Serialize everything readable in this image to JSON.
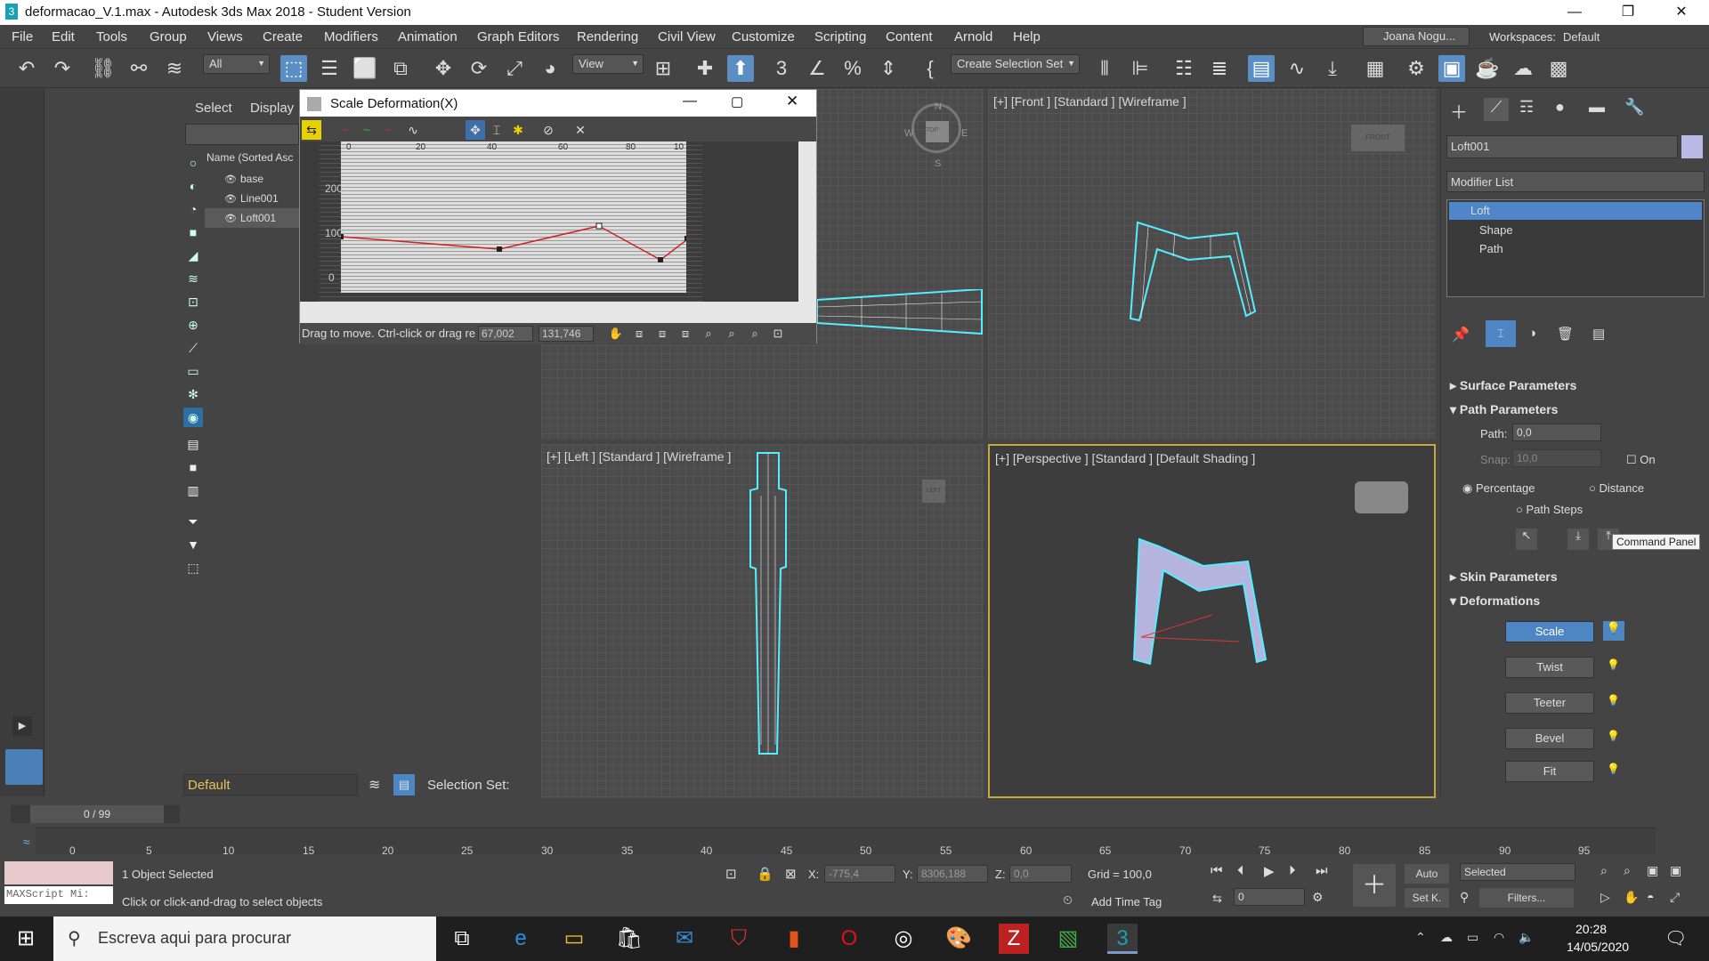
{
  "window": {
    "title": "deformacao_V.1.max - Autodesk 3ds Max 2018 - Student Version",
    "logo": "3"
  },
  "menu": [
    "File",
    "Edit",
    "Tools",
    "Group",
    "Views",
    "Create",
    "Modifiers",
    "Animation",
    "Graph Editors",
    "Rendering",
    "Civil View",
    "Customize",
    "Scripting",
    "Content",
    "Arnold",
    "Help"
  ],
  "user": {
    "name": "Joana Nogu...",
    "workspaces_label": "Workspaces:",
    "workspace": "Default"
  },
  "toolbar": {
    "filter": "All",
    "view": "View",
    "selection_set": "Create Selection Set"
  },
  "scene": {
    "tab_select": "Select",
    "tab_display": "Display",
    "column_header": "Name (Sorted Asc",
    "items": [
      "base",
      "Line001",
      "Loft001"
    ]
  },
  "dialog": {
    "title": "Scale Deformation(X)",
    "ruler": [
      "0",
      "20",
      "40",
      "60",
      "80",
      "10"
    ],
    "yticks": [
      "200",
      "100",
      "0"
    ],
    "status": "Drag to move. Ctrl-click or drag re",
    "x_value": "67,002",
    "y_value": "131,746"
  },
  "viewports": {
    "top": "",
    "front": "[+] [Front ] [Standard ] [Wireframe ]",
    "left": "[+] [Left ] [Standard ] [Wireframe ]",
    "perspective": "[+] [Perspective ] [Standard ] [Default Shading ]",
    "cube_front": "FRONT",
    "cube_left": "LEFT",
    "cube_top": "TOP",
    "compass": {
      "n": "N",
      "s": "S",
      "e": "E",
      "w": "W"
    }
  },
  "panel": {
    "object_name": "Loft001",
    "modifier_list": "Modifier List",
    "stack": [
      "Loft",
      "Shape",
      "Path"
    ],
    "surface_params": "Surface Parameters",
    "path_params": "Path Parameters",
    "path_label": "Path:",
    "path_value": "0,0",
    "snap_label": "Snap:",
    "snap_value": "10,0",
    "on_label": "On",
    "percentage": "Percentage",
    "distance": "Distance",
    "path_steps": "Path Steps",
    "tooltip": "Command Panel",
    "skin_params": "Skin Parameters",
    "deformations": "Deformations",
    "deform_buttons": [
      "Scale",
      "Twist",
      "Teeter",
      "Bevel",
      "Fit"
    ]
  },
  "bottom": {
    "layer": "Default",
    "selection_set_label": "Selection Set:",
    "frame_counter": "0 / 99",
    "ticks": [
      "0",
      "5",
      "10",
      "15",
      "20",
      "25",
      "30",
      "35",
      "40",
      "45",
      "50",
      "55",
      "60",
      "65",
      "70",
      "75",
      "80",
      "85",
      "90",
      "95"
    ],
    "maxscript": "MAXScript Mi:",
    "status1": "1 Object Selected",
    "status2": "Click or click-and-drag to select objects",
    "x_label": "X:",
    "x_value": "-775,4",
    "y_label": "Y:",
    "y_value": "8306,188",
    "z_label": "Z:",
    "z_value": "0,0",
    "grid": "Grid = 100,0",
    "add_time_tag": "Add Time Tag",
    "auto": "Auto",
    "setk": "Set K.",
    "selected": "Selected",
    "filters": "Filters...",
    "frame": "0"
  },
  "taskbar": {
    "search": "Escreva aqui para procurar",
    "time": "20:28",
    "date": "14/05/2020"
  }
}
